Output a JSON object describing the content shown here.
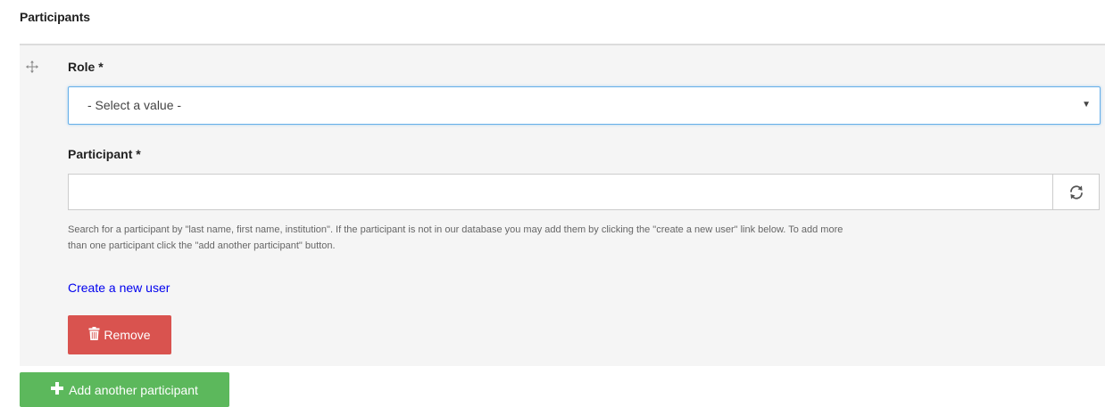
{
  "section": {
    "title": "Participants"
  },
  "role": {
    "label": "Role *",
    "selected": "- Select a value -"
  },
  "participant": {
    "label": "Participant *",
    "value": "",
    "help_line1": "Search for a participant by \"last name, first name, institution\". If the participant is not in our database you may add them by clicking the \"create a new user\" link below. To add more",
    "help_line2": "than one participant click the \"add another participant\" button."
  },
  "links": {
    "create_user": "Create a new user"
  },
  "buttons": {
    "remove": "Remove",
    "add_participant": "Add another participant"
  },
  "icons": {
    "drag": "move-icon",
    "refresh": "refresh-icon",
    "trash": "trash-icon",
    "plus": "plus-icon",
    "caret": "caret-down-icon"
  },
  "colors": {
    "remove_button": "#d9534f",
    "add_button": "#5cb85c",
    "link": "#0000ee",
    "focus_border": "#66afe9",
    "panel_bg": "#f5f5f5"
  }
}
